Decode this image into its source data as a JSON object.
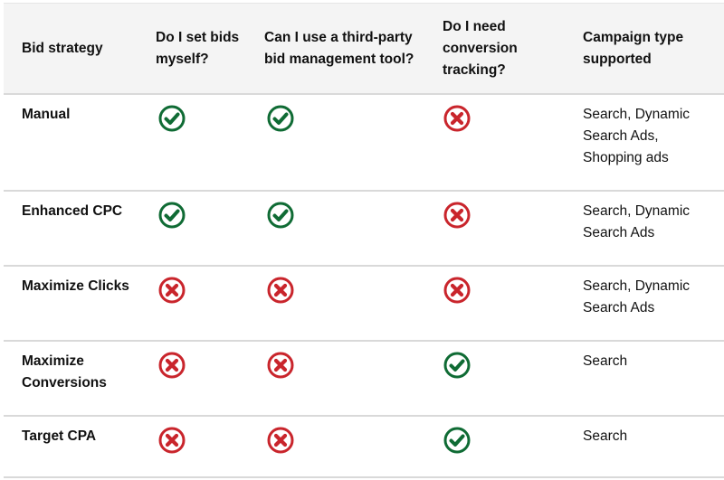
{
  "colors": {
    "yes": "#0f6b34",
    "no": "#c9252c",
    "header_bg": "#f4f4f4",
    "divider": "#d9d9d9"
  },
  "table": {
    "headers": [
      "Bid strategy",
      "Do I set bids myself?",
      "Can I use a third-party bid management tool?",
      "Do I need conversion tracking?",
      "Campaign type supported"
    ],
    "rows": [
      {
        "strategy": "Manual",
        "set_bids": "yes",
        "third_party": "yes",
        "conversion_tracking": "no",
        "campaign_types": "Search, Dynamic Search Ads, Shopping ads"
      },
      {
        "strategy": "Enhanced CPC",
        "set_bids": "yes",
        "third_party": "yes",
        "conversion_tracking": "no",
        "campaign_types": "Search, Dynamic Search Ads"
      },
      {
        "strategy": "Maximize Clicks",
        "set_bids": "no",
        "third_party": "no",
        "conversion_tracking": "no",
        "campaign_types": "Search, Dynamic Search Ads"
      },
      {
        "strategy": "Maximize Conversions",
        "set_bids": "no",
        "third_party": "no",
        "conversion_tracking": "yes",
        "campaign_types": "Search"
      },
      {
        "strategy": "Target CPA",
        "set_bids": "no",
        "third_party": "no",
        "conversion_tracking": "yes",
        "campaign_types": "Search"
      }
    ]
  }
}
